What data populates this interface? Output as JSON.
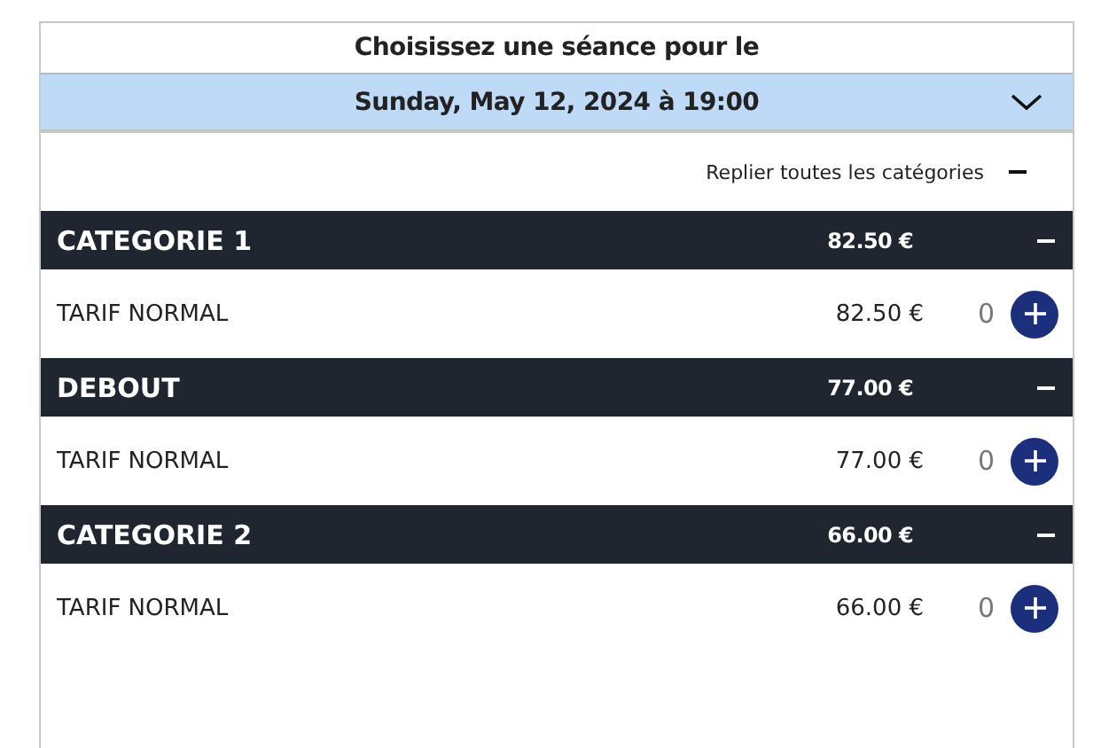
{
  "heading": "Choisissez une séance pour le",
  "session_select": {
    "value": "Sunday, May 12, 2024 à 19:00"
  },
  "collapse_all": {
    "label": "Replier toutes les catégories"
  },
  "categories": [
    {
      "name": "CATEGORIE 1",
      "price": "82.50 €",
      "expanded": true,
      "tariffs": [
        {
          "name": "TARIF NORMAL",
          "price": "82.50 €",
          "quantity": "0"
        }
      ]
    },
    {
      "name": "DEBOUT",
      "price": "77.00 €",
      "expanded": true,
      "tariffs": [
        {
          "name": "TARIF NORMAL",
          "price": "77.00 €",
          "quantity": "0"
        }
      ]
    },
    {
      "name": "CATEGORIE 2",
      "price": "66.00 €",
      "expanded": true,
      "tariffs": [
        {
          "name": "TARIF NORMAL",
          "price": "66.00 €",
          "quantity": "0"
        }
      ]
    }
  ]
}
